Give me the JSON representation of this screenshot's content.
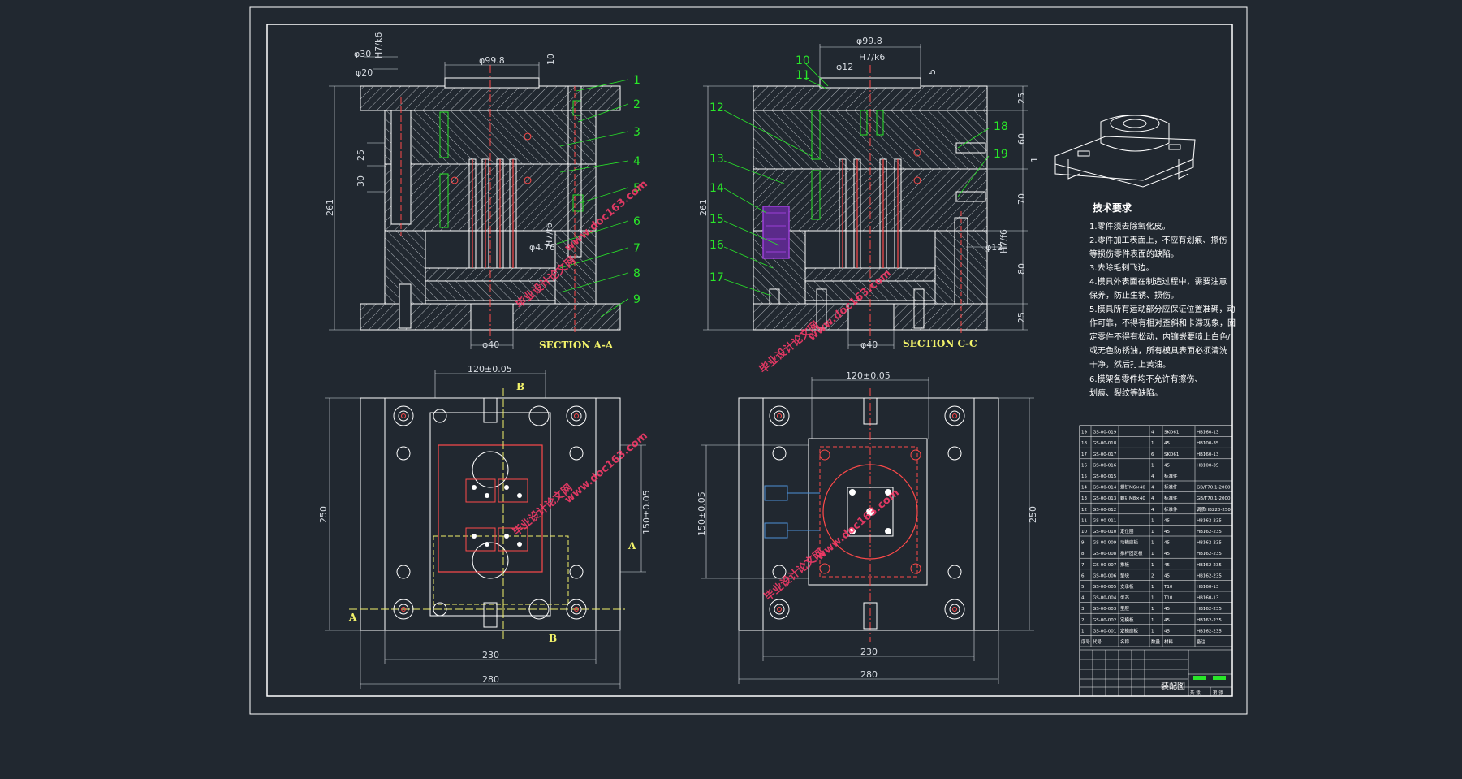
{
  "views": {
    "section_a": {
      "title": "SECTION A-A",
      "dims": {
        "top_width": "φ99.8",
        "d30": "φ30",
        "d20": "φ20",
        "fit1": "H7/k6",
        "d10": "10",
        "v25": "25",
        "v30": "30",
        "height": "261",
        "d476": "φ4.76",
        "fit2": "H7/f6",
        "bottom": "φ40"
      },
      "balloons": [
        "1",
        "2",
        "3",
        "4",
        "5",
        "6",
        "7",
        "8",
        "9"
      ]
    },
    "section_c": {
      "title": "SECTION C-C",
      "dims": {
        "top_width": "φ99.8",
        "d12": "φ12",
        "fit1": "H7/k6",
        "d5": "5",
        "height": "261",
        "v25a": "25",
        "v60": "60",
        "v1": "1",
        "v70": "70",
        "d12b": "φ12",
        "fit2": "H7/f6",
        "v80": "80",
        "v25b": "25",
        "bottom": "φ40"
      },
      "balloons": [
        "10",
        "11",
        "12",
        "13",
        "14",
        "15",
        "16",
        "17",
        "18",
        "19"
      ]
    },
    "plan_left": {
      "dims": {
        "top": "120±0.05",
        "left": "250",
        "right": "150±0.05",
        "w230": "230",
        "w280": "280"
      },
      "labels": {
        "b_top": "B",
        "b_bottom": "B",
        "a_left": "A",
        "a_right": "A"
      }
    },
    "plan_right": {
      "dims": {
        "top": "120±0.05",
        "left": "150±0.05",
        "right": "250",
        "w230": "230",
        "w280": "280"
      }
    }
  },
  "technical_requirements": {
    "title": "技术要求",
    "lines": [
      "1.零件须去除氧化皮。",
      "2.零件加工表面上，不应有划痕、擦伤",
      "等损伤零件表面的缺陷。",
      "3.去除毛刺飞边。",
      "4.模具外表面在制造过程中，需要注意",
      "保养，防止生锈、损伤。",
      "5.模具所有运动部分应保证位置准确，动",
      "作可靠，不得有相对歪斜和卡滞现象，固",
      "定零件不得有松动，内镶嵌要喷上白色/",
      "或无色防锈油，所有模具表面必须清洗",
      "干净，然后打上黄油。",
      "6.模架各零件均不允许有擦伤、",
      "划痕、裂纹等缺陷。"
    ]
  },
  "bom": {
    "rows": [
      [
        "19",
        "GS-00-019",
        "",
        "4",
        "SKD61",
        "HB160-13"
      ],
      [
        "18",
        "GS-00-018",
        "",
        "1",
        "45",
        "HB100-35"
      ],
      [
        "17",
        "GS-00-017",
        "",
        "6",
        "SKD61",
        "HB160-13"
      ],
      [
        "16",
        "GS-00-016",
        "",
        "1",
        "45",
        "HB100-35"
      ],
      [
        "15",
        "GS-00-015",
        "",
        "4",
        "标准件",
        ""
      ],
      [
        "14",
        "GS-00-014",
        "螺钉M6×40",
        "4",
        "标准件",
        "GB/T70.1-2000"
      ],
      [
        "13",
        "GS-00-013",
        "螺钉M8×40",
        "4",
        "标准件",
        "GB/T70.1-2000"
      ],
      [
        "12",
        "GS-00-012",
        "",
        "4",
        "标准件",
        "调质HB220-250"
      ],
      [
        "11",
        "GS-00-011",
        "",
        "1",
        "45",
        "HB162-235"
      ],
      [
        "10",
        "GS-00-010",
        "定位圈",
        "1",
        "45",
        "HB162-235"
      ],
      [
        "9",
        "GS-00-009",
        "动模座板",
        "1",
        "45",
        "HB162-235"
      ],
      [
        "8",
        "GS-00-008",
        "推杆固定板",
        "1",
        "45",
        "HB162-235"
      ],
      [
        "7",
        "GS-00-007",
        "推板",
        "1",
        "45",
        "HB162-235"
      ],
      [
        "6",
        "GS-00-006",
        "垫块",
        "2",
        "45",
        "HB162-235"
      ],
      [
        "5",
        "GS-00-005",
        "支承板",
        "1",
        "T10",
        "HB160-13"
      ],
      [
        "4",
        "GS-00-004",
        "型芯",
        "1",
        "T10",
        "HB160-13"
      ],
      [
        "3",
        "GS-00-003",
        "型腔",
        "1",
        "45",
        "HB162-235"
      ],
      [
        "2",
        "GS-00-002",
        "定模板",
        "1",
        "45",
        "HB162-235"
      ],
      [
        "1",
        "GS-00-001",
        "定模座板",
        "1",
        "45",
        "HB162-235"
      ]
    ],
    "header": [
      "序号",
      "代号",
      "名称",
      "数量",
      "材料",
      "备注"
    ],
    "title_name": "装配图",
    "footer": [
      "共 张",
      "第 张"
    ]
  },
  "watermarks": [
    "毕业设计论文网",
    "www.doc163.com"
  ],
  "colors": {
    "background": "#212830",
    "frame": "#ffffff",
    "dim": "#d8dde3",
    "green": "#29e629",
    "red": "#ff4a4a",
    "yellow": "#f2f26a",
    "purple": "#9b3fd6"
  }
}
